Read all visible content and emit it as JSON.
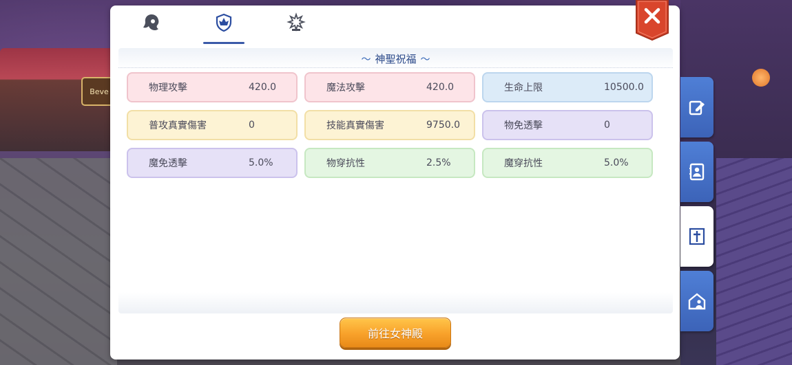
{
  "background": {
    "sign_text": "Beve"
  },
  "tabs": [
    {
      "name": "appearance",
      "icon": "hair-silhouette-icon",
      "active": false
    },
    {
      "name": "blessing",
      "icon": "shield-crest-icon",
      "active": true
    },
    {
      "name": "emblem",
      "icon": "sparkle-emblem-icon",
      "active": false
    }
  ],
  "close_icon": "close-icon",
  "section": {
    "title": "神聖祝福",
    "swirl_left": "〜",
    "swirl_right": "〜"
  },
  "stats": [
    {
      "label": "物理攻擊",
      "value": "420.0",
      "color": "pink"
    },
    {
      "label": "魔法攻擊",
      "value": "420.0",
      "color": "pink"
    },
    {
      "label": "生命上限",
      "value": "10500.0",
      "color": "blue"
    },
    {
      "label": "普攻真實傷害",
      "value": "0",
      "color": "yellow"
    },
    {
      "label": "技能真實傷害",
      "value": "9750.0",
      "color": "yellow"
    },
    {
      "label": "物免透擊",
      "value": "0",
      "color": "purple"
    },
    {
      "label": "魔免透擊",
      "value": "5.0%",
      "color": "purple"
    },
    {
      "label": "物穿抗性",
      "value": "2.5%",
      "color": "green"
    },
    {
      "label": "魔穿抗性",
      "value": "5.0%",
      "color": "green"
    }
  ],
  "action_button": {
    "label": "前往女神殿"
  },
  "side_tabs": [
    {
      "name": "edit",
      "icon": "edit-note-icon",
      "active": false
    },
    {
      "name": "contacts",
      "icon": "contact-book-icon",
      "active": false
    },
    {
      "name": "sanctuary",
      "icon": "cross-icon",
      "active": true
    },
    {
      "name": "guild-house",
      "icon": "house-person-icon",
      "active": false
    }
  ],
  "colors": {
    "accent": "#3a5aa8",
    "close_red": "#d9452c",
    "button_orange": "#f8a12a",
    "side_tab_blue": "#4373c8"
  }
}
